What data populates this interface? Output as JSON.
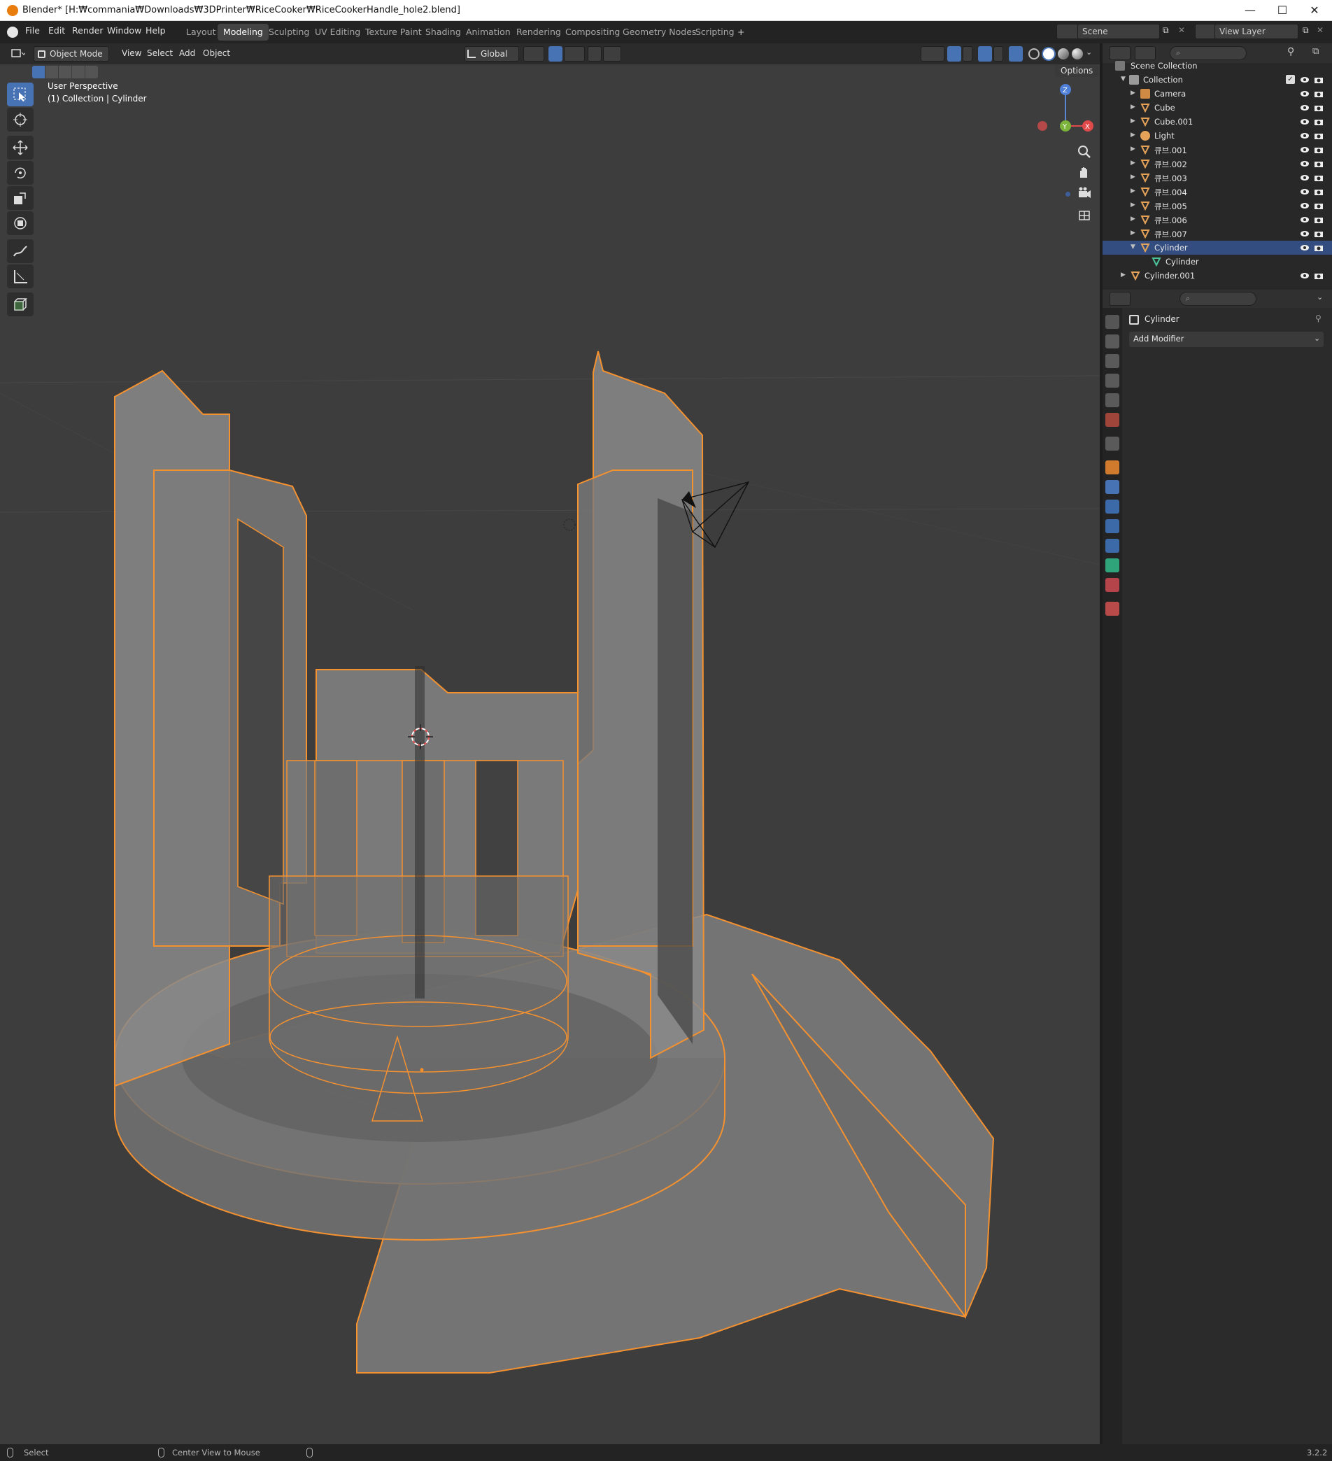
{
  "window": {
    "title": "Blender* [H:₩commania₩Downloads₩3DPrinter₩RiceCooker₩RiceCookerHandle_hole2.blend]",
    "minimize": "—",
    "maximize": "☐",
    "close": "✕"
  },
  "menu": [
    "File",
    "Edit",
    "Render",
    "Window",
    "Help"
  ],
  "workspaces": [
    "Layout",
    "Modeling",
    "Sculpting",
    "UV Editing",
    "Texture Paint",
    "Shading",
    "Animation",
    "Rendering",
    "Compositing",
    "Geometry Nodes",
    "Scripting"
  ],
  "active_workspace": "Modeling",
  "add_workspace": "+",
  "scene": {
    "name": "Scene",
    "view_layer": "View Layer"
  },
  "viewport_header": {
    "mode": "Object Mode",
    "menus": [
      "View",
      "Select",
      "Add",
      "Object"
    ],
    "orientation": "Global",
    "options": "Options"
  },
  "viewport": {
    "perspective": "User Perspective",
    "context": "(1) Collection | Cylinder",
    "axes": {
      "x": "X",
      "y": "Y",
      "z": "Z"
    }
  },
  "outliner": {
    "root": "Scene Collection",
    "collection": "Collection",
    "items": [
      {
        "name": "Camera",
        "type": "camera"
      },
      {
        "name": "Cube",
        "type": "mesh"
      },
      {
        "name": "Cube.001",
        "type": "mesh"
      },
      {
        "name": "Light",
        "type": "light"
      },
      {
        "name": "큐브.001",
        "type": "mesh"
      },
      {
        "name": "큐브.002",
        "type": "mesh"
      },
      {
        "name": "큐브.003",
        "type": "mesh"
      },
      {
        "name": "큐브.004",
        "type": "mesh"
      },
      {
        "name": "큐브.005",
        "type": "mesh"
      },
      {
        "name": "큐브.006",
        "type": "mesh"
      },
      {
        "name": "큐브.007",
        "type": "mesh"
      },
      {
        "name": "Cylinder",
        "type": "mesh",
        "selected": true
      },
      {
        "name": "Cylinder",
        "type": "meshdata",
        "child": true
      },
      {
        "name": "Cylinder.001",
        "type": "mesh",
        "top_level": true
      }
    ]
  },
  "properties": {
    "object_name": "Cylinder",
    "add_modifier": "Add Modifier"
  },
  "statusbar": {
    "left": "Select",
    "middle": "Center View to Mouse",
    "version": "3.2.2"
  },
  "colors": {
    "accent": "#4772b3",
    "selection_outline": "#f5912f",
    "selected_row": "#334d80",
    "viewport_bg": "#3d3d3d"
  }
}
